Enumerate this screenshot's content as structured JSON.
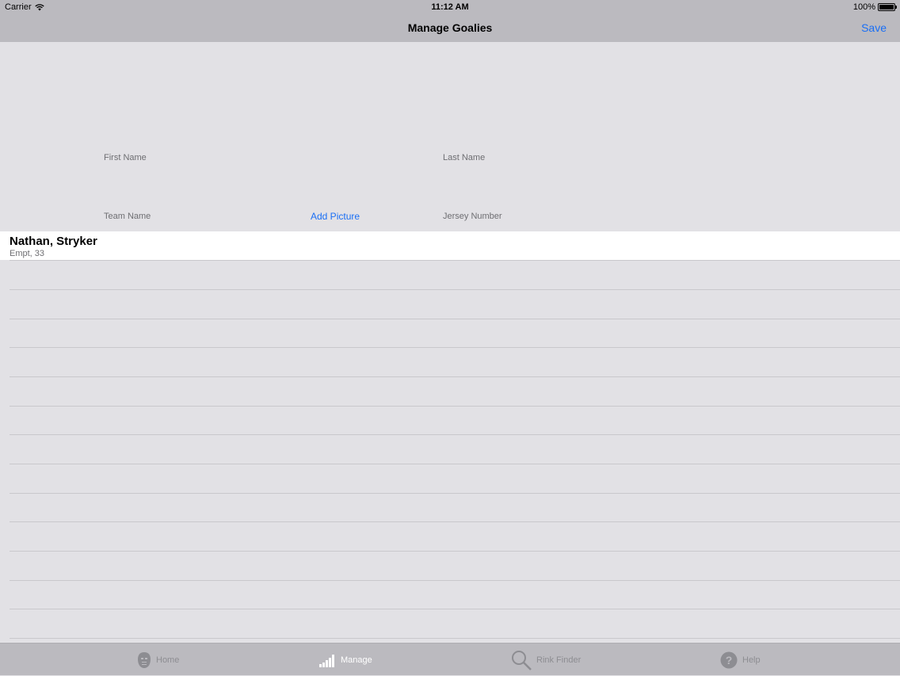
{
  "status_bar": {
    "carrier": "Carrier",
    "time": "11:12 AM",
    "battery": "100%"
  },
  "nav": {
    "title": "Manage Goalies",
    "save_label": "Save"
  },
  "form": {
    "first_name_placeholder": "First Name",
    "last_name_placeholder": "Last Name",
    "team_name_placeholder": "Team Name",
    "add_picture_label": "Add Picture",
    "jersey_number_placeholder": "Jersey Number"
  },
  "goalies": [
    {
      "name": "Nathan, Stryker",
      "detail": "Empt, 33"
    }
  ],
  "tabs": [
    {
      "label": "Home",
      "icon": "goalie-mask-icon"
    },
    {
      "label": "Manage",
      "icon": "bar-signal-icon"
    },
    {
      "label": "Rink Finder",
      "icon": "magnifier-icon"
    },
    {
      "label": "Help",
      "icon": "question-circle-icon"
    }
  ],
  "colors": {
    "accent": "#1a6ff5",
    "bar_background": "#bbbabf",
    "page_background": "#e2e1e5"
  }
}
